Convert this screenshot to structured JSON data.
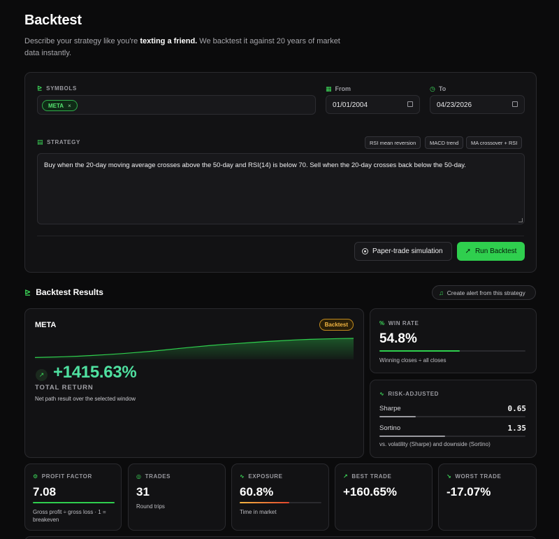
{
  "header": {
    "title": "Backtest",
    "subtitle_before": "Describe your strategy like you're ",
    "subtitle_bold": "texting a friend.",
    "subtitle_after": " We backtest it against 20 years of market data instantly."
  },
  "form": {
    "symbols_label": "SYMBOLS",
    "symbols": [
      "META"
    ],
    "chip_remove": "×",
    "from_label": "From",
    "from_value": "01/01/2004",
    "to_label": "To",
    "to_value": "04/23/2026",
    "strategy_label": "STRATEGY",
    "presets": [
      "RSI mean reversion",
      "MACD trend",
      "MA crossover + RSI"
    ],
    "strategy_text": "Buy when the 20-day moving average crosses above the 50-day and RSI(14) is below 70. Sell when the 20-day crosses back below the 50-day.",
    "paper_trade_label": "Paper-trade simulation",
    "run_label": "Run Backtest"
  },
  "results": {
    "title": "Backtest Results",
    "alert_label": "Create alert from this strategy",
    "hero": {
      "symbol": "META",
      "badge": "Backtest",
      "total_return": "+1415.63%",
      "total_return_label": "TOTAL RETURN",
      "note": "Net path result over the selected window",
      "sparkline": [
        0.02,
        0.04,
        0.06,
        0.09,
        0.13,
        0.17,
        0.22,
        0.28,
        0.34,
        0.41,
        0.49,
        0.56,
        0.63,
        0.69,
        0.74,
        0.79,
        0.84,
        0.88,
        0.92,
        0.95,
        0.97,
        0.99,
        1.0
      ]
    },
    "win_rate": {
      "label": "WIN RATE",
      "value": "54.8%",
      "fraction": 0.548,
      "caption": "Winning closes ÷ all closes"
    },
    "risk_adjusted": {
      "label": "RISK-ADJUSTED",
      "sharpe_label": "Sharpe",
      "sharpe_value": "0.65",
      "sharpe_fraction": 0.25,
      "sortino_label": "Sortino",
      "sortino_value": "1.35",
      "sortino_fraction": 0.45,
      "caption": "vs. volatility (Sharpe) and downside (Sortino)"
    },
    "stats": {
      "profit_factor": {
        "label": "PROFIT FACTOR",
        "value": "7.08",
        "caption": "Gross profit ÷ gross loss · 1 = breakeven",
        "fraction": 1.0
      },
      "trades": {
        "label": "TRADES",
        "value": "31",
        "caption": "Round trips"
      },
      "exposure": {
        "label": "EXPOSURE",
        "value": "60.8%",
        "caption": "Time in market",
        "fraction": 0.608
      },
      "best_trade": {
        "label": "BEST TRADE",
        "value": "+160.65%"
      },
      "worst_trade": {
        "label": "WORST TRADE",
        "value": "-17.07%"
      }
    }
  },
  "colors": {
    "accent": "#2fcf4e",
    "return_green": "#4fe0a0",
    "badge_amber": "#f3b642",
    "background": "#0b0b0c",
    "card": "#121214"
  },
  "icons": {
    "symbols": "chart-line-icon",
    "from": "calendar-icon",
    "to": "calendar-clock-icon",
    "strategy": "document-icon",
    "paper_trade": "target-icon",
    "run": "rocket-icon",
    "results": "chart-icon",
    "alert": "bell-icon",
    "return": "trend-up-icon",
    "win_rate": "percent-icon",
    "risk": "activity-icon",
    "profit_factor": "gear-icon",
    "trades": "cycle-icon",
    "exposure": "pulse-icon",
    "best_trade": "trend-up-icon",
    "worst_trade": "trend-down-icon"
  }
}
